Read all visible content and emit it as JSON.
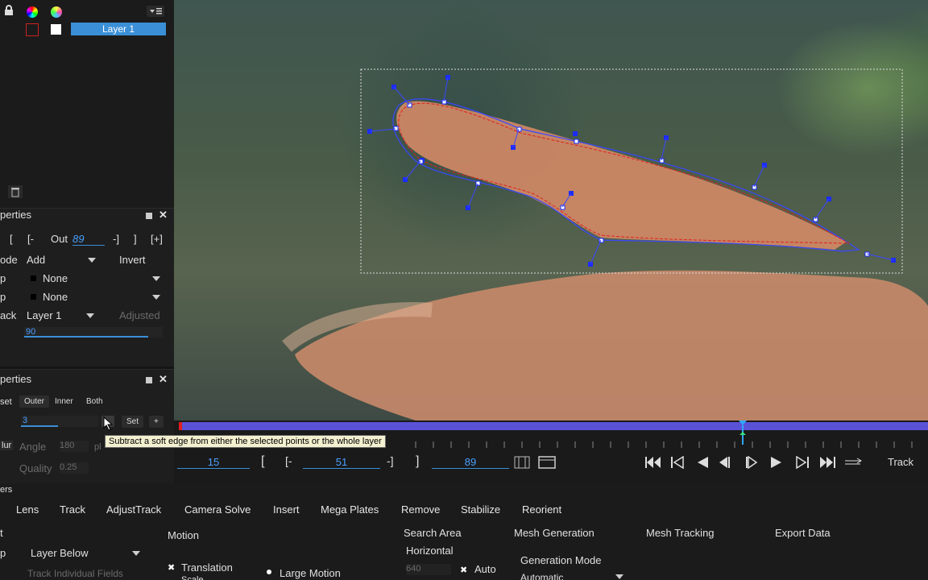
{
  "layers": {
    "lock": "🔒",
    "layer_name": "Layer 1"
  },
  "layer_props": {
    "title": "perties",
    "in_out": {
      "out_label": "Out",
      "out_value": "89",
      "b1": "[",
      "b2": "[-",
      "b3": "-]",
      "b4": "]",
      "b5": "[+]"
    },
    "mode": {
      "label": "ode",
      "value": "Add",
      "invert": "Invert"
    },
    "row3": {
      "label": "p",
      "value": "None"
    },
    "row4": {
      "label": "p",
      "value": "None"
    },
    "track": {
      "label": "ack",
      "value": "Layer 1",
      "adjusted": "Adjusted"
    },
    "opacity": "90"
  },
  "edge_props": {
    "title": "perties",
    "set_label": "set",
    "modes": [
      "Outer",
      "Inner",
      "Both"
    ],
    "width": "3",
    "set_btn": "Set",
    "plus_btn": "+",
    "blur_label": "lur",
    "angle_label": "Angle",
    "angle_value": "180",
    "pl_label": "pl",
    "quality_label": "Quality",
    "quality_value": "0.25"
  },
  "tooltip": "Subtract a soft edge from either the selected points or the whole layer",
  "timeline": {
    "in_frame": "15",
    "cur_frame": "51",
    "out_frame": "89",
    "b_open": "[",
    "b_open_dash": "[-",
    "b_close_dash": "-]",
    "b_close": "]",
    "track_label": "Track",
    "colors": {
      "bar": "#5a52d6",
      "playhead": "#2fa7ff",
      "in_marker": "#e02020"
    }
  },
  "bottom": {
    "left_label": "ers",
    "tabs": [
      "Lens",
      "Track",
      "AdjustTrack",
      "Camera Solve",
      "Insert",
      "Mega Plates",
      "Remove",
      "Stabilize",
      "Reorient"
    ],
    "left_field_label": "t",
    "layer_row_label": "p",
    "layer_below": "Layer Below",
    "track_individual": "Track Individual Fields",
    "motion": "Motion",
    "translation": "Translation",
    "scale": "Scale",
    "large_motion": "Large Motion",
    "search_area": "Search Area",
    "horizontal": "Horizontal",
    "horizontal_value": "640",
    "auto": "Auto",
    "mesh_generation": "Mesh Generation",
    "generation_mode": "Generation Mode",
    "gen_mode_value": "Automatic",
    "mesh_tracking": "Mesh Tracking",
    "export_data": "Export Data"
  },
  "icons": {
    "lock": "lock-icon",
    "trash": "trash-icon",
    "pin": "pin-icon",
    "close": "close-icon"
  }
}
